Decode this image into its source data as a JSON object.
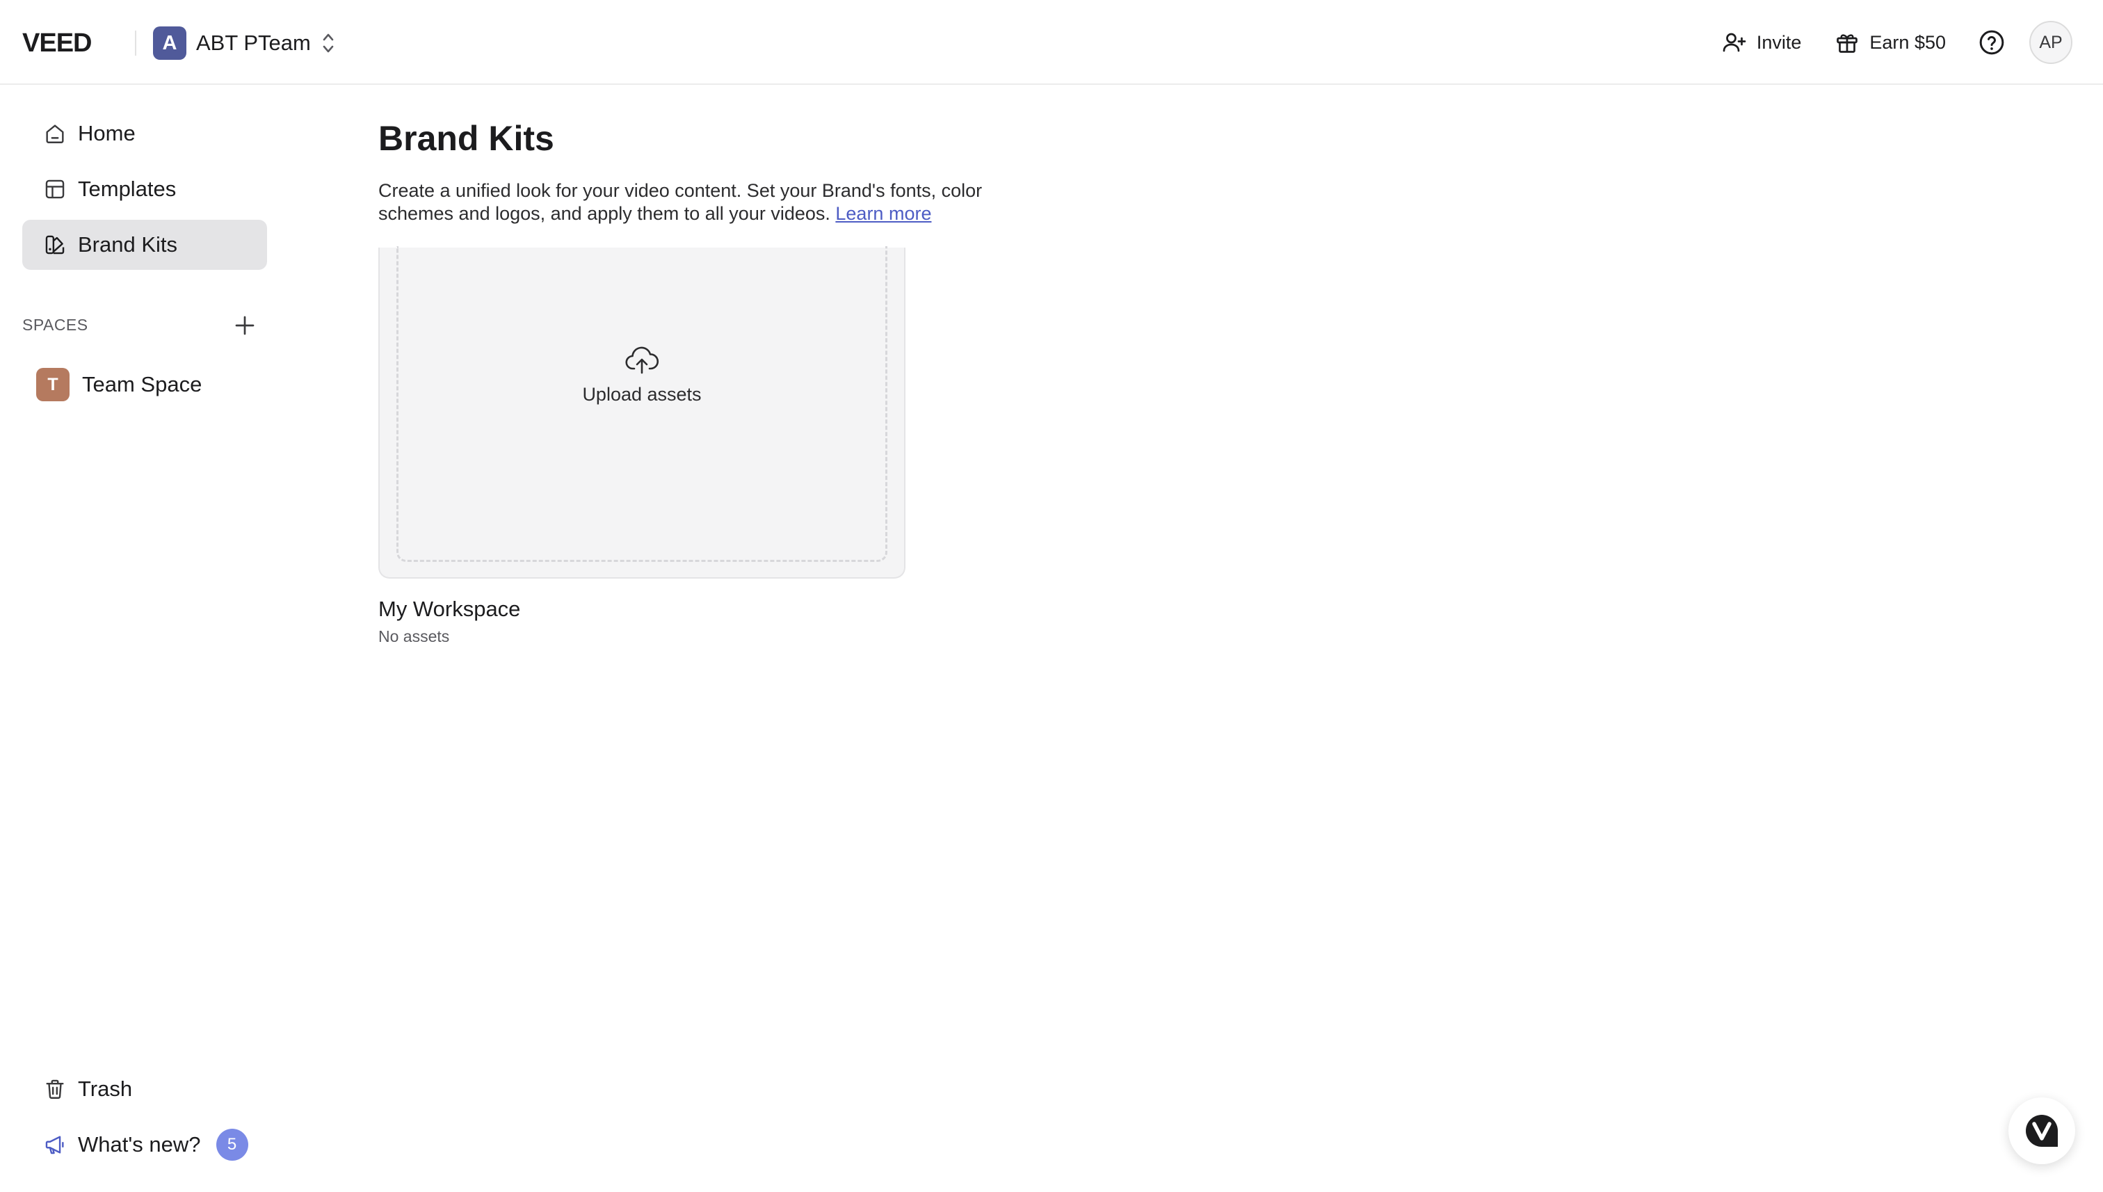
{
  "app": {
    "logo_text": "VEED",
    "workspace_initial": "A",
    "workspace_name": "ABT PTeam"
  },
  "header": {
    "invite_label": "Invite",
    "earn_label": "Earn $50",
    "user_initials": "AP"
  },
  "sidebar": {
    "items": [
      {
        "label": "Home",
        "icon": "home-icon"
      },
      {
        "label": "Templates",
        "icon": "templates-icon"
      },
      {
        "label": "Brand Kits",
        "icon": "brand-kits-icon",
        "active": true
      }
    ],
    "spaces_label": "SPACES",
    "spaces": [
      {
        "initial": "T",
        "label": "Team Space"
      }
    ],
    "bottom": {
      "trash_label": "Trash",
      "whats_new_label": "What's new?",
      "whats_new_count": "5"
    }
  },
  "main": {
    "title": "Brand Kits",
    "description": "Create a unified look for your video content. Set your Brand's fonts, color schemes and logos, and apply them to all your videos.",
    "learn_more": "Learn more",
    "kit": {
      "upload_label": "Upload assets",
      "name": "My Workspace",
      "meta": "No assets"
    }
  },
  "colors": {
    "workspace_avatar": "#505a9a",
    "space_avatar": "#b57a5f",
    "badge": "#7a8ae6",
    "link": "#4d5cc4",
    "active_nav": "#e4e4e6"
  }
}
